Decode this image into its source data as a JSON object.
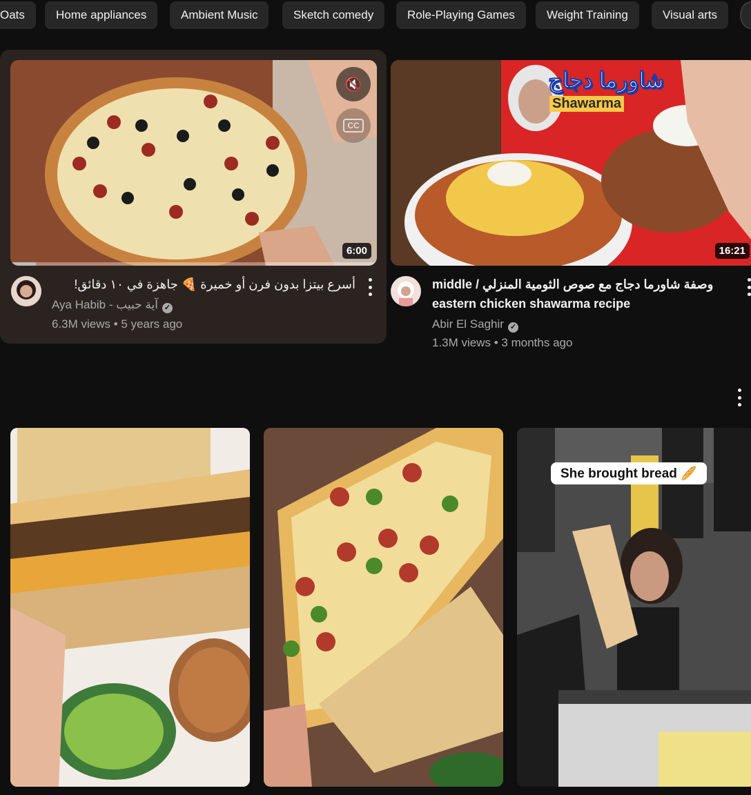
{
  "chips": [
    "Oats",
    "Home appliances",
    "Ambient Music",
    "Sketch comedy",
    "Role-Playing Games",
    "Weight Training",
    "Visual arts"
  ],
  "videos": [
    {
      "title": "أسرع بيتزا بدون فرن أو خميرة 🍕 جاهزة في ١٠ دقائق!",
      "channel": "Aya Habib - آية حبيب",
      "meta": "6.3M views • 5 years ago",
      "duration": "6:00",
      "progress_fraction": 0.07
    },
    {
      "title_line1": "middle / وصفة شاورما دجاج مع صوص الثومية المنزلي",
      "title_line2": "eastern chicken shawarma recipe",
      "channel": "Abir El Saghir",
      "meta": "1.3M views • 3 months ago",
      "duration": "16:21",
      "thumb_title_ar": "شاورما دجاج",
      "thumb_title_en": "Shawarma"
    }
  ],
  "shorts": [
    {
      "caption": ""
    },
    {
      "caption": ""
    },
    {
      "caption": "She brought bread 🥖"
    }
  ],
  "icons": [
    "mute-icon",
    "closed-captions-icon",
    "verified-icon",
    "more-vert-icon"
  ],
  "colors": {
    "background": "#0f0f0f",
    "chip": "#272727",
    "hover_card": "#2a2320",
    "text_secondary": "#aaaaaa"
  }
}
